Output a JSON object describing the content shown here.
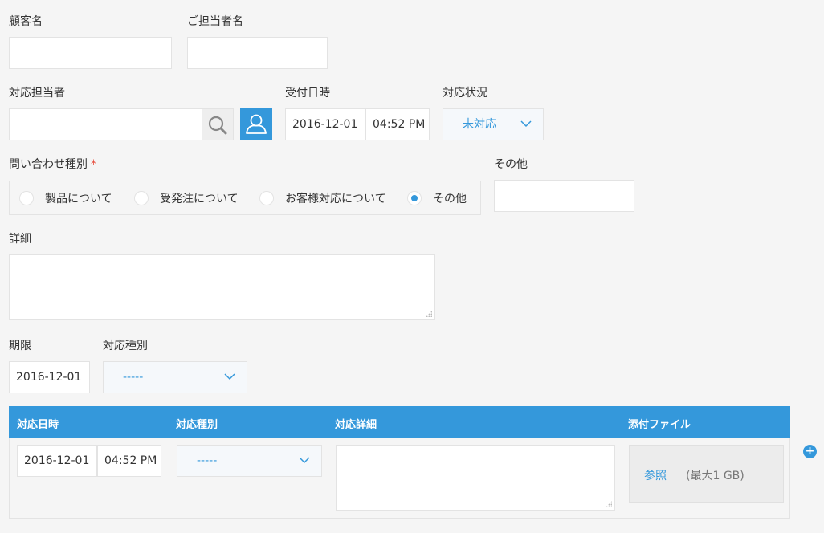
{
  "customer": {
    "label": "顧客名",
    "value": ""
  },
  "contact_person": {
    "label": "ご担当者名",
    "value": ""
  },
  "assignee": {
    "label": "対応担当者",
    "value": "",
    "search_icon": "search-icon",
    "user_icon": "user-icon"
  },
  "received": {
    "label": "受付日時",
    "date": "2016-12-01",
    "time": "04:52 PM"
  },
  "status": {
    "label": "対応状況",
    "value": "未対応"
  },
  "inquiry_type": {
    "label": "問い合わせ種別",
    "required_mark": "*",
    "options": [
      "製品について",
      "受発注について",
      "お客様対応について",
      "その他"
    ],
    "selected": "その他"
  },
  "other": {
    "label": "その他",
    "value": ""
  },
  "details": {
    "label": "詳細",
    "value": ""
  },
  "deadline": {
    "label": "期限",
    "value": "2016-12-01"
  },
  "response_type": {
    "label": "対応種別",
    "value": "-----"
  },
  "table": {
    "headers": [
      "対応日時",
      "対応種別",
      "対応詳細",
      "添付ファイル"
    ],
    "row": {
      "date": "2016-12-01",
      "time": "04:52 PM",
      "type": "-----",
      "detail": "",
      "browse_label": "参照",
      "max_size": "(最大1 GB)"
    },
    "add_icon": "plus-circle-icon",
    "add_label": "+"
  },
  "colors": {
    "accent": "#3498db",
    "background": "#f5f5f5",
    "required": "#e74c3c"
  }
}
